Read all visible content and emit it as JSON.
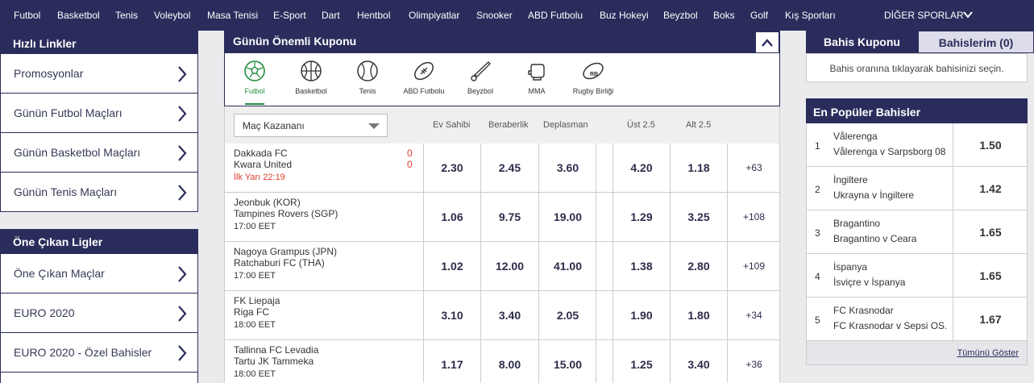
{
  "topnav": {
    "items": [
      "Futbol",
      "Basketbol",
      "Tenis",
      "Voleybol",
      "Masa Tenisi",
      "E-Sport",
      "Dart",
      "Hentbol",
      "Olimpiyatlar",
      "Snooker",
      "ABD Futbolu",
      "Buz Hokeyi",
      "Beyzbol",
      "Boks",
      "Golf",
      "Kış Sporları"
    ],
    "more": "DİĞER SPORLAR"
  },
  "quick_links": {
    "title": "Hızlı Linkler",
    "items": [
      "Promosyonlar",
      "Günün Futbol Maçları",
      "Günün Basketbol Maçları",
      "Günün Tenis Maçları"
    ]
  },
  "featured_leagues": {
    "title": "Öne Çıkan Ligler",
    "items": [
      "Öne Çıkan Maçlar",
      "EURO 2020",
      "EURO 2020 - Özel Bahisler"
    ]
  },
  "coupon": {
    "title": "Günün Önemli Kuponu",
    "sports": [
      "Futbol",
      "Basketbol",
      "Tenis",
      "ABD Futbolu",
      "Beyzbol",
      "MMA",
      "Rugby Birliği"
    ],
    "market_select": "Maç Kazananı",
    "columns": [
      "Ev Sahibi",
      "Beraberlik",
      "Deplasman",
      "Üst 2.5",
      "Alt 2.5"
    ],
    "matches": [
      {
        "home": "Dakkada FC",
        "away": "Kwara United",
        "time": "İlk Yarı  22:19",
        "live": true,
        "score_home": "0",
        "score_away": "0",
        "odds": [
          "2.30",
          "2.45",
          "3.60",
          "4.20",
          "1.18"
        ],
        "more": "+63"
      },
      {
        "home": "Jeonbuk (KOR)",
        "away": "Tampines Rovers (SGP)",
        "time": "17:00 EET",
        "live": false,
        "score_home": "",
        "score_away": "",
        "odds": [
          "1.06",
          "9.75",
          "19.00",
          "1.29",
          "3.25"
        ],
        "more": "+108"
      },
      {
        "home": "Nagoya Grampus (JPN)",
        "away": "Ratchaburi FC (THA)",
        "time": "17:00 EET",
        "live": false,
        "score_home": "",
        "score_away": "",
        "odds": [
          "1.02",
          "12.00",
          "41.00",
          "1.38",
          "2.80"
        ],
        "more": "+109"
      },
      {
        "home": "FK Liepaja",
        "away": "Riga FC",
        "time": "18:00 EET",
        "live": false,
        "score_home": "",
        "score_away": "",
        "odds": [
          "3.10",
          "3.40",
          "2.05",
          "1.90",
          "1.80"
        ],
        "more": "+34"
      },
      {
        "home": "Tallinna FC Levadia",
        "away": "Tartu JK Tammeka",
        "time": "18:00 EET",
        "live": false,
        "score_home": "",
        "score_away": "",
        "odds": [
          "1.17",
          "8.00",
          "15.00",
          "1.25",
          "3.40"
        ],
        "more": "+36"
      }
    ]
  },
  "betslip": {
    "tab_active": "Bahis Kuponu",
    "tab_other": "Bahislerim (0)",
    "info": "Bahis oranına tıklayarak bahisinizi seçin."
  },
  "popular": {
    "title": "En Popüler Bahisler",
    "items": [
      {
        "num": "1",
        "selection": "Vålerenga",
        "event": "Vålerenga v Sarpsborg 08",
        "odd": "1.50"
      },
      {
        "num": "2",
        "selection": "İngiltere",
        "event": "Ukrayna v İngiltere",
        "odd": "1.42"
      },
      {
        "num": "3",
        "selection": "Bragantino",
        "event": "Bragantino v Ceara",
        "odd": "1.65"
      },
      {
        "num": "4",
        "selection": "İspanya",
        "event": "İsviçre v İspanya",
        "odd": "1.65"
      },
      {
        "num": "5",
        "selection": "FC Krasnodar",
        "event": "FC Krasnodar v Sepsi OS...",
        "odd": "1.67"
      }
    ],
    "show_all": "Tümünü Göster"
  },
  "colors": {
    "navy": "#2a2d5c",
    "live": "#e03c31",
    "active_sport": "#1f8c3b"
  }
}
